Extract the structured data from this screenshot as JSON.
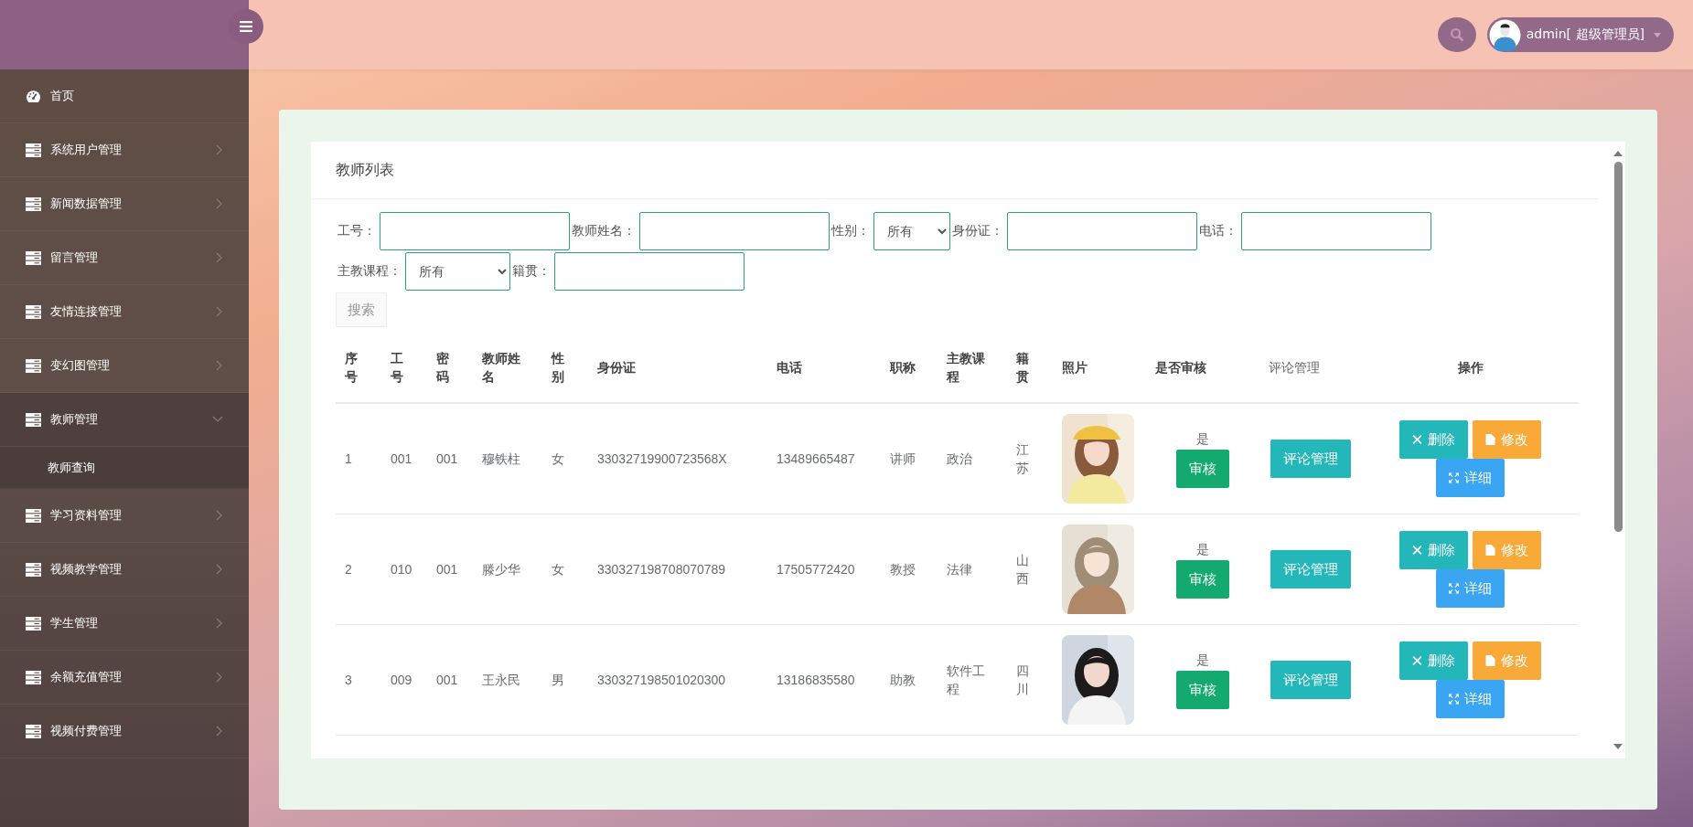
{
  "header": {
    "user": "admin[ 超级管理员]"
  },
  "sidebar": {
    "items": [
      {
        "kind": "home",
        "label": "首页",
        "expanded": false
      },
      {
        "kind": "menu",
        "label": "系统用户管理",
        "expanded": false
      },
      {
        "kind": "menu",
        "label": "新闻数据管理",
        "expanded": false
      },
      {
        "kind": "menu",
        "label": "留言管理",
        "expanded": false
      },
      {
        "kind": "menu",
        "label": "友情连接管理",
        "expanded": false
      },
      {
        "kind": "menu",
        "label": "变幻图管理",
        "expanded": false
      },
      {
        "kind": "menu",
        "label": "教师管理",
        "expanded": true,
        "children": [
          {
            "label": "教师查询"
          }
        ]
      },
      {
        "kind": "menu",
        "label": "学习资料管理",
        "expanded": false
      },
      {
        "kind": "menu",
        "label": "视频教学管理",
        "expanded": false
      },
      {
        "kind": "menu",
        "label": "学生管理",
        "expanded": false
      },
      {
        "kind": "menu",
        "label": "余额充值管理",
        "expanded": false
      },
      {
        "kind": "menu",
        "label": "视频付费管理",
        "expanded": false
      }
    ]
  },
  "panel": {
    "title": "教师列表",
    "filters": [
      {
        "label": "工号：",
        "kind": "text"
      },
      {
        "label": "教师姓名：",
        "kind": "text"
      },
      {
        "label": "性别：",
        "kind": "select",
        "value": "所有"
      },
      {
        "label": "身份证：",
        "kind": "text"
      },
      {
        "label": "电话：",
        "kind": "text"
      },
      {
        "label": "主教课程：",
        "kind": "select",
        "value": "所有"
      },
      {
        "label": "籍贯：",
        "kind": "text"
      }
    ],
    "search_button": "搜索",
    "table": {
      "columns": [
        "序号",
        "工号",
        "密码",
        "教师姓名",
        "性别",
        "身份证",
        "电话",
        "职称",
        "主教课程",
        "籍贯",
        "照片",
        "是否审核",
        "评论管理",
        "操作"
      ],
      "rows": [
        {
          "cells": [
            "1",
            "001",
            "001",
            "穆铁柱",
            "女",
            "33032719900723568X",
            "13489665487",
            "讲师",
            "政治",
            "江苏"
          ],
          "approved": "是",
          "audit": "审核",
          "comments": "评论管理",
          "actions": [
            {
              "kind": "delete",
              "label": "删除"
            },
            {
              "kind": "edit",
              "label": "修改"
            },
            {
              "kind": "detail",
              "label": "详细"
            }
          ]
        },
        {
          "cells": [
            "2",
            "010",
            "001",
            "滕少华",
            "女",
            "330327198708070789",
            "17505772420",
            "教授",
            "法律",
            "山西"
          ],
          "approved": "是",
          "audit": "审核",
          "comments": "评论管理",
          "actions": [
            {
              "kind": "delete",
              "label": "删除"
            },
            {
              "kind": "edit",
              "label": "修改"
            },
            {
              "kind": "detail",
              "label": "详细"
            }
          ]
        },
        {
          "cells": [
            "3",
            "009",
            "001",
            "王永民",
            "男",
            "330327198501020300",
            "13186835580",
            "助教",
            "软件工程",
            "四川"
          ],
          "approved": "是",
          "audit": "审核",
          "comments": "评论管理",
          "actions": [
            {
              "kind": "delete",
              "label": "删除"
            },
            {
              "kind": "edit",
              "label": "修改"
            },
            {
              "kind": "detail",
              "label": "详细"
            }
          ]
        }
      ]
    }
  }
}
